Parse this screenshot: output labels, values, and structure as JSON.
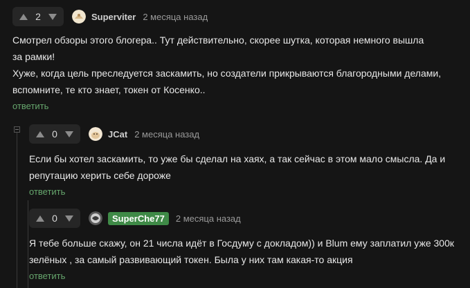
{
  "comments": [
    {
      "score": "2",
      "author": "Superviter",
      "time": "2 месяца назад",
      "lines": [
        "Смотрел обзоры этого блогера.. Тут действительно, скорее шутка, которая немного вышла",
        "за рамки!",
        "Хуже, когда цель преследуется заскамить, но создатели прикрываются благородными делами,",
        "вспомните, те кто знает, токен от Косенко.."
      ],
      "reply_label": "ответить"
    },
    {
      "score": "0",
      "author": "JCat",
      "time": "2 месяца назад",
      "lines": [
        "Если бы хотел заскамить, то уже бы сделал на хаях, а так сейчас в этом мало смысла. Да и",
        "репутацию херить себе дороже"
      ],
      "reply_label": "ответить"
    },
    {
      "score": "0",
      "author": "SuperChe77",
      "time": "2 месяца назад",
      "lines": [
        "Я тебе больше скажу, он 21 числа идёт в Госдуму с докладом)) и Blum ему заплатил уже 300к",
        "зелёных , за самый развивающий токен. Была у них там какая-то акция"
      ],
      "reply_label": "ответить"
    }
  ],
  "colors": {
    "background": "#151515",
    "reply_link": "#66a66d",
    "author_badge": "#3f8a47",
    "vote_box": "#262626"
  }
}
